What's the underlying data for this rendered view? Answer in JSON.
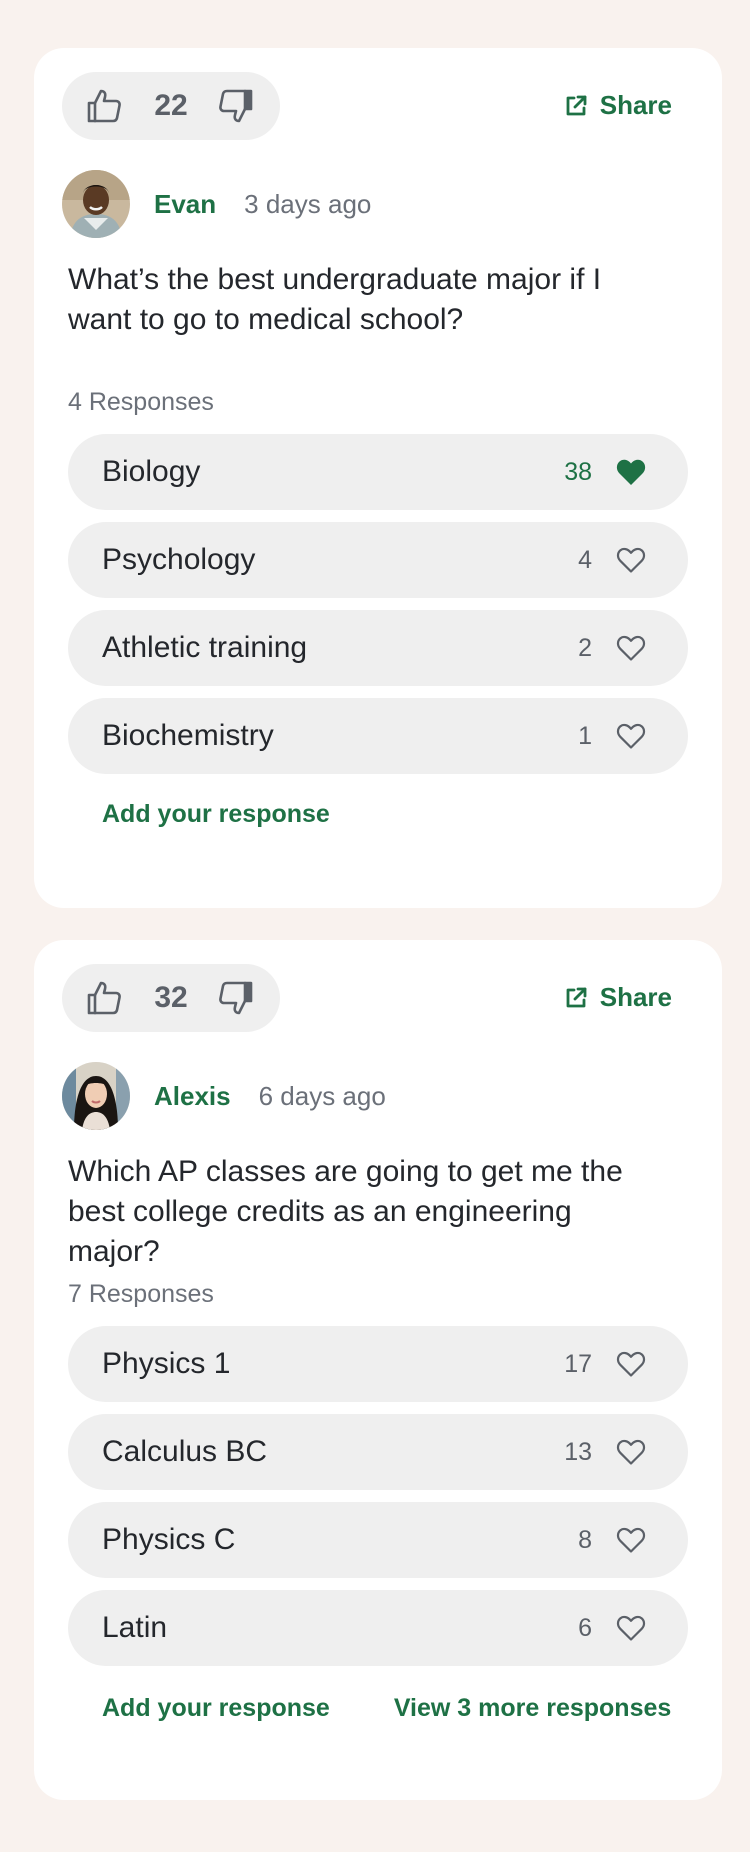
{
  "posts": [
    {
      "votes": "22",
      "share_label": "Share",
      "author": "Evan",
      "time_ago": "3 days ago",
      "question": "What’s the best undergraduate major if I want to go to medical school?",
      "responses_count_label": "4 Responses",
      "responses": [
        {
          "label": "Biology",
          "likes": "38",
          "liked": true
        },
        {
          "label": "Psychology",
          "likes": "4",
          "liked": false
        },
        {
          "label": "Athletic training",
          "likes": "2",
          "liked": false
        },
        {
          "label": "Biochemistry",
          "likes": "1",
          "liked": false
        }
      ],
      "add_response_label": "Add your response",
      "more_responses_label": ""
    },
    {
      "votes": "32",
      "share_label": "Share",
      "author": "Alexis",
      "time_ago": "6 days ago",
      "question": "Which AP classes are going to get me the best college credits as an engineering major?",
      "responses_count_label": "7 Responses",
      "responses": [
        {
          "label": "Physics 1",
          "likes": "17",
          "liked": false
        },
        {
          "label": "Calculus BC",
          "likes": "13",
          "liked": false
        },
        {
          "label": "Physics C",
          "likes": "8",
          "liked": false
        },
        {
          "label": "Latin",
          "likes": "6",
          "liked": false
        }
      ],
      "add_response_label": "Add your response",
      "more_responses_label": "View 3 more responses"
    }
  ],
  "icons": {
    "thumb_up": "thumbs-up-icon",
    "thumb_down": "thumbs-down-icon",
    "share": "external-link-icon",
    "heart": "heart-icon"
  },
  "colors": {
    "accent": "#1e7145",
    "background": "#f9f2ee",
    "card": "#ffffff",
    "pill": "#efefef",
    "muted_text": "#6b7079"
  }
}
